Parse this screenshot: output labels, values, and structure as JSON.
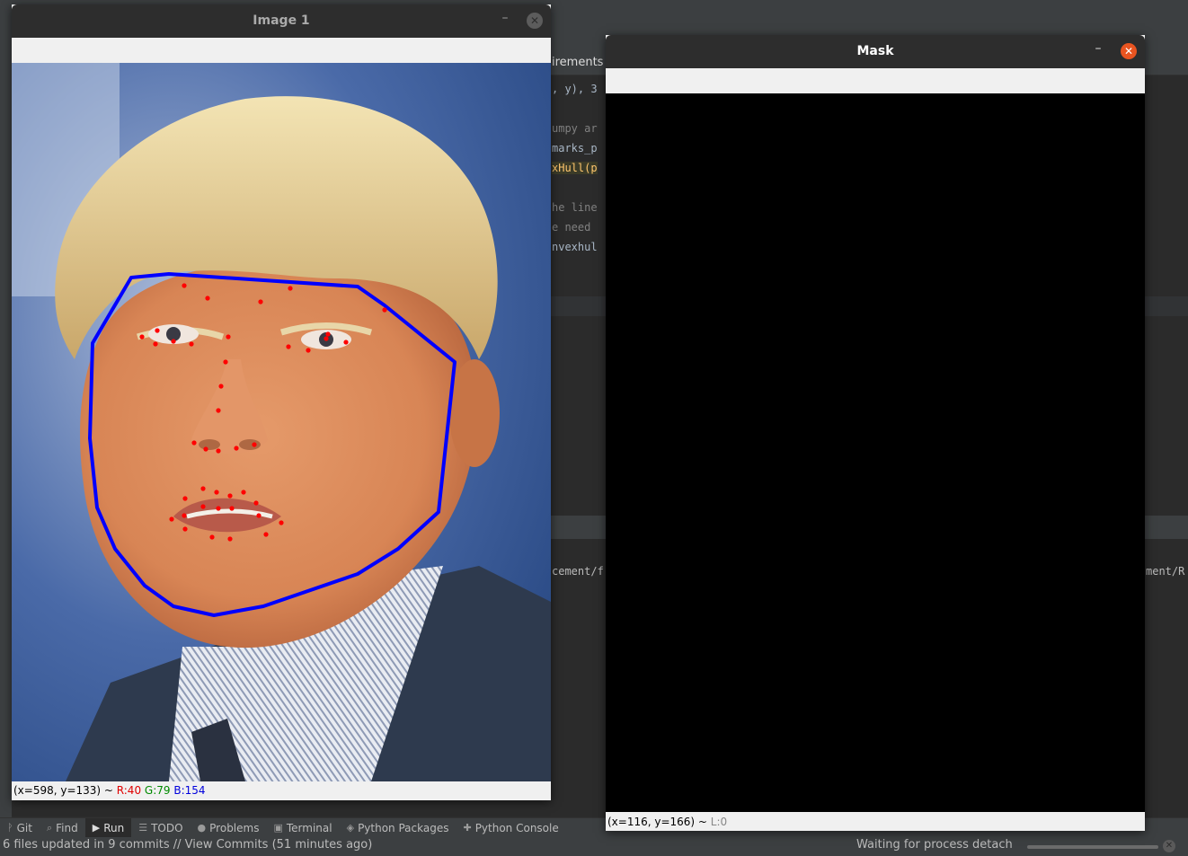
{
  "ide": {
    "code_fragments": [
      "irements",
      ", y), 3",
      "umpy ar",
      "marks_p",
      "xHull(p",
      "he line",
      "e need",
      "nvexhul"
    ],
    "run_path_left": "cement/f",
    "run_path_right": "ment/R",
    "toolwindows": [
      {
        "icon": "git-icon",
        "glyph": "ᚹ",
        "label": "Git"
      },
      {
        "icon": "find-icon",
        "glyph": "⌕",
        "label": "Find"
      },
      {
        "icon": "run-icon",
        "glyph": "▶",
        "label": "Run"
      },
      {
        "icon": "todo-icon",
        "glyph": "☰",
        "label": "TODO"
      },
      {
        "icon": "problems-icon",
        "glyph": "●",
        "label": "Problems"
      },
      {
        "icon": "terminal-icon",
        "glyph": "▣",
        "label": "Terminal"
      },
      {
        "icon": "python-packages-icon",
        "glyph": "◈",
        "label": "Python Packages"
      },
      {
        "icon": "python-console-icon",
        "glyph": "✚",
        "label": "Python Console"
      }
    ],
    "status_left": "6 files updated in 9 commits // View Commits (51 minutes ago)",
    "status_right": "Waiting for process detach"
  },
  "image_window": {
    "title": "Image 1",
    "minimize_glyph": "–",
    "close_glyph": "✕",
    "status_coords": "(x=598, y=133) ~ ",
    "status_r": "R:40",
    "status_g": "G:79",
    "status_b": "B:154",
    "hull_color": "#0000ff",
    "landmark_color": "#ff0000"
  },
  "mask_window": {
    "title": "Mask",
    "minimize_glyph": "–",
    "close_glyph": "✕",
    "status_coords": "(x=116, y=166) ~ ",
    "status_l": "L:0"
  }
}
